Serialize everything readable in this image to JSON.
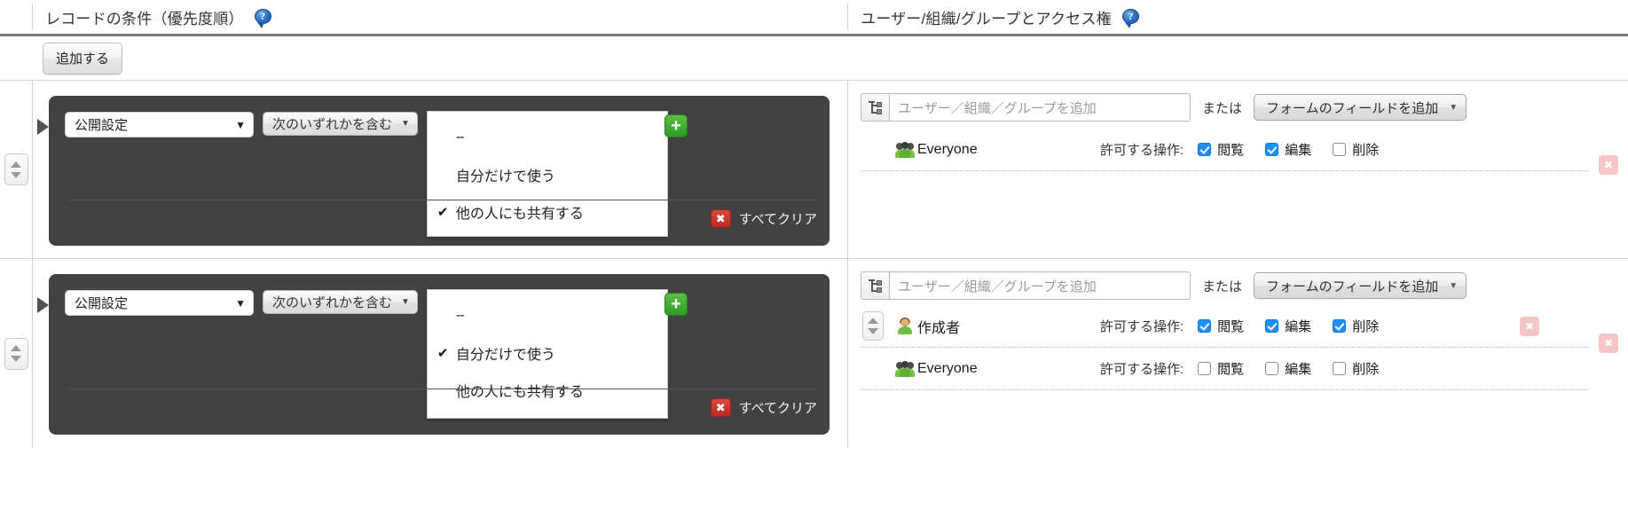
{
  "header": {
    "left_title": "レコードの条件（優先度順）",
    "right_title": "ユーザー/組織/グループとアクセス権",
    "help_glyph": "?",
    "help_icon_name": "help-icon"
  },
  "toolbar": {
    "add_label": "追加する"
  },
  "icons": {
    "plus": "+",
    "x": "✖",
    "check": "✔",
    "caret_down": "▼",
    "caret_small": "▼"
  },
  "colors": {
    "panel_dark": "#424242",
    "accent_green": "#2e9b23",
    "accent_red": "#bb2a23",
    "checkbox_on": "#1e8fff",
    "header_rule": "#7a7a7a"
  },
  "condition_rows": [
    {
      "field_label": "公開設定",
      "operator_label": "次のいずれかを含む",
      "options": [
        {
          "label": "--",
          "checked": false
        },
        {
          "label": "自分だけで使う",
          "checked": false
        },
        {
          "label": "他の人にも共有する",
          "checked": true
        }
      ],
      "clear_label": "すべてクリア",
      "add_value_label": "+"
    },
    {
      "field_label": "公開設定",
      "operator_label": "次のいずれかを含む",
      "options": [
        {
          "label": "--",
          "checked": false
        },
        {
          "label": "自分だけで使う",
          "checked": true
        },
        {
          "label": "他の人にも共有する",
          "checked": false
        }
      ],
      "clear_label": "すべてクリア",
      "add_value_label": "+"
    }
  ],
  "acl_rows": [
    {
      "lookup_placeholder": "ユーザー／組織／グループを追加",
      "or_label": "または",
      "field_button_label": "フォームのフィールドを追加",
      "entries": [
        {
          "name": "Everyone",
          "icon": "people-icon",
          "has_spinner": false,
          "has_delete": false,
          "perm_label": "許可する操作:",
          "permissions": [
            {
              "label": "閲覧",
              "checked": true
            },
            {
              "label": "編集",
              "checked": true
            },
            {
              "label": "削除",
              "checked": false
            }
          ]
        }
      ]
    },
    {
      "lookup_placeholder": "ユーザー／組織／グループを追加",
      "or_label": "または",
      "field_button_label": "フォームのフィールドを追加",
      "entries": [
        {
          "name": "作成者",
          "icon": "person-icon",
          "has_spinner": true,
          "has_delete": true,
          "perm_label": "許可する操作:",
          "permissions": [
            {
              "label": "閲覧",
              "checked": true
            },
            {
              "label": "編集",
              "checked": true
            },
            {
              "label": "削除",
              "checked": true
            }
          ]
        },
        {
          "name": "Everyone",
          "icon": "people-icon",
          "has_spinner": false,
          "has_delete": false,
          "perm_label": "許可する操作:",
          "permissions": [
            {
              "label": "閲覧",
              "checked": false
            },
            {
              "label": "編集",
              "checked": false
            },
            {
              "label": "削除",
              "checked": false
            }
          ]
        }
      ]
    }
  ],
  "row_delete_label": "✖"
}
